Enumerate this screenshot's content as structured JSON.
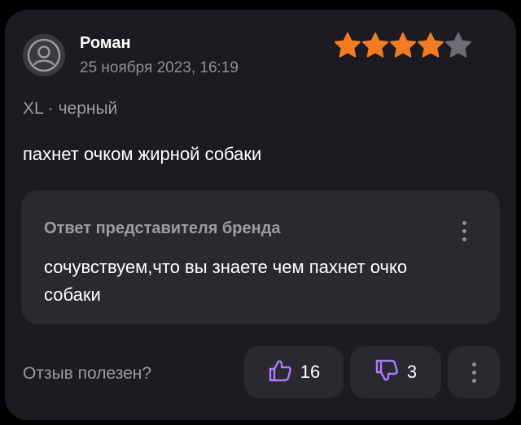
{
  "review": {
    "author": "Роман",
    "date": "25 ноября 2023, 16:19",
    "rating": 4,
    "rating_max": 5,
    "variant": "XL · черный",
    "text": "пахнет очком жирной собаки"
  },
  "reply": {
    "title": "Ответ представителя бренда",
    "text": "сочувствуем,что вы знаете чем пахнет очко собаки"
  },
  "footer": {
    "helpful_label": "Отзыв полезен?",
    "likes": "16",
    "dislikes": "3"
  },
  "colors": {
    "card_bg": "#1c1b21",
    "panel_bg": "#2a2930",
    "star_filled": "#f47c20",
    "star_empty": "#6d6c74",
    "vote_icon": "#a97bff",
    "muted_text": "#9a99a1"
  },
  "icons": {
    "avatar": "user-avatar-icon",
    "star": "star-icon",
    "like": "thumbs-up-icon",
    "dislike": "thumbs-down-icon",
    "menu": "vertical-ellipsis-icon"
  }
}
